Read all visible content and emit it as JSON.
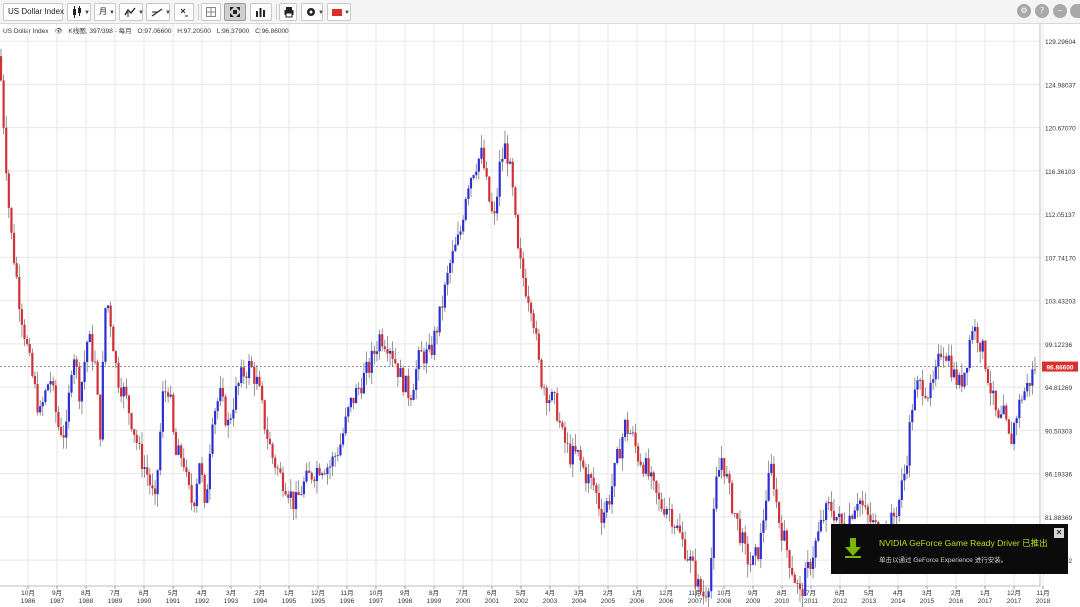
{
  "toolbar": {
    "symbol_label": "US Dollar Index",
    "interval_label": "月",
    "colors": {
      "active_bg": "#cfcfcf",
      "flag_red": "#d9302c"
    }
  },
  "chart_info": {
    "name": "US Dollar Index",
    "kline": "K线图, 397/398 - 每月",
    "open": "O:97.06600",
    "high": "H:97.20500",
    "low": "L:96.37900",
    "close": "C:96.86000"
  },
  "chart_data": {
    "type": "candlestick",
    "interval": "monthly",
    "current_price": 96.866,
    "current_price_label": "96.86600",
    "ylim": [
      75,
      131
    ],
    "y_ticks": [
      "129.29604",
      "124.98037",
      "120.67070",
      "116.36103",
      "112.05137",
      "107.74170",
      "103.43203",
      "99.12236",
      "94.81269",
      "90.50303",
      "86.19336",
      "81.88369",
      "77.57402"
    ],
    "x_ticks": [
      {
        "m": "10月",
        "y": "1986"
      },
      {
        "m": "9月",
        "y": "1987"
      },
      {
        "m": "8月",
        "y": "1988"
      },
      {
        "m": "7月",
        "y": "1989"
      },
      {
        "m": "6月",
        "y": "1990"
      },
      {
        "m": "5月",
        "y": "1991"
      },
      {
        "m": "4月",
        "y": "1992"
      },
      {
        "m": "3月",
        "y": "1993"
      },
      {
        "m": "2月",
        "y": "1994"
      },
      {
        "m": "1月",
        "y": "1995"
      },
      {
        "m": "12月",
        "y": "1995"
      },
      {
        "m": "11月",
        "y": "1996"
      },
      {
        "m": "10月",
        "y": "1997"
      },
      {
        "m": "9月",
        "y": "1998"
      },
      {
        "m": "8月",
        "y": "1999"
      },
      {
        "m": "7月",
        "y": "2000"
      },
      {
        "m": "6月",
        "y": "2001"
      },
      {
        "m": "5月",
        "y": "2002"
      },
      {
        "m": "4月",
        "y": "2003"
      },
      {
        "m": "3月",
        "y": "2004"
      },
      {
        "m": "2月",
        "y": "2005"
      },
      {
        "m": "1月",
        "y": "2006"
      },
      {
        "m": "12月",
        "y": "2006"
      },
      {
        "m": "11月",
        "y": "2007"
      },
      {
        "m": "10月",
        "y": "2008"
      },
      {
        "m": "9月",
        "y": "2009"
      },
      {
        "m": "8月",
        "y": "2010"
      },
      {
        "m": "7月",
        "y": "2011"
      },
      {
        "m": "6月",
        "y": "2012"
      },
      {
        "m": "5月",
        "y": "2013"
      },
      {
        "m": "4月",
        "y": "2014"
      },
      {
        "m": "3月",
        "y": "2015"
      },
      {
        "m": "2月",
        "y": "2016"
      },
      {
        "m": "1月",
        "y": "2017"
      },
      {
        "m": "12月",
        "y": "2017"
      },
      {
        "m": "11月",
        "y": "2018"
      }
    ],
    "anchors": [
      [
        0,
        127
      ],
      [
        10,
        111
      ],
      [
        20,
        103
      ],
      [
        30,
        97
      ],
      [
        40,
        92
      ],
      [
        50,
        96
      ],
      [
        58,
        91
      ],
      [
        66,
        90
      ],
      [
        73,
        99
      ],
      [
        80,
        94
      ],
      [
        88,
        100
      ],
      [
        95,
        97
      ],
      [
        100,
        90
      ],
      [
        106,
        104
      ],
      [
        110,
        102
      ],
      [
        117,
        96
      ],
      [
        125,
        94
      ],
      [
        133,
        91
      ],
      [
        140,
        88
      ],
      [
        148,
        86
      ],
      [
        155,
        83
      ],
      [
        163,
        94
      ],
      [
        169,
        95
      ],
      [
        175,
        88
      ],
      [
        183,
        88
      ],
      [
        187,
        85
      ],
      [
        193,
        83
      ],
      [
        200,
        88
      ],
      [
        205,
        82
      ],
      [
        212,
        92
      ],
      [
        220,
        94
      ],
      [
        228,
        91
      ],
      [
        235,
        94
      ],
      [
        242,
        96
      ],
      [
        250,
        97
      ],
      [
        258,
        95
      ],
      [
        265,
        91
      ],
      [
        272,
        88
      ],
      [
        280,
        86
      ],
      [
        287,
        85
      ],
      [
        295,
        83
      ],
      [
        303,
        85
      ],
      [
        310,
        86
      ],
      [
        320,
        87
      ],
      [
        330,
        87
      ],
      [
        340,
        89
      ],
      [
        350,
        93
      ],
      [
        360,
        95
      ],
      [
        370,
        97
      ],
      [
        380,
        100
      ],
      [
        390,
        99
      ],
      [
        400,
        96
      ],
      [
        410,
        94
      ],
      [
        420,
        98
      ],
      [
        430,
        98
      ],
      [
        440,
        102
      ],
      [
        450,
        107
      ],
      [
        460,
        110
      ],
      [
        467,
        115
      ],
      [
        475,
        117
      ],
      [
        482,
        118
      ],
      [
        488,
        114
      ],
      [
        494,
        111
      ],
      [
        500,
        117
      ],
      [
        506,
        119
      ],
      [
        512,
        115
      ],
      [
        518,
        108
      ],
      [
        525,
        105
      ],
      [
        532,
        103
      ],
      [
        540,
        96
      ],
      [
        548,
        94
      ],
      [
        556,
        93
      ],
      [
        562,
        90
      ],
      [
        570,
        88
      ],
      [
        578,
        88
      ],
      [
        586,
        86
      ],
      [
        594,
        85
      ],
      [
        602,
        82
      ],
      [
        610,
        84
      ],
      [
        618,
        88
      ],
      [
        625,
        91
      ],
      [
        632,
        90
      ],
      [
        638,
        88
      ],
      [
        645,
        87
      ],
      [
        652,
        85
      ],
      [
        660,
        83
      ],
      [
        668,
        83
      ],
      [
        676,
        81
      ],
      [
        684,
        79
      ],
      [
        692,
        77
      ],
      [
        698,
        75
      ],
      [
        704,
        74
      ],
      [
        710,
        76
      ],
      [
        716,
        85
      ],
      [
        722,
        88
      ],
      [
        730,
        84
      ],
      [
        738,
        81
      ],
      [
        746,
        78
      ],
      [
        752,
        77
      ],
      [
        760,
        79
      ],
      [
        766,
        84
      ],
      [
        772,
        87
      ],
      [
        778,
        82
      ],
      [
        786,
        79
      ],
      [
        794,
        76
      ],
      [
        800,
        74
      ],
      [
        806,
        76
      ],
      [
        812,
        78
      ],
      [
        818,
        80
      ],
      [
        824,
        82
      ],
      [
        830,
        83
      ],
      [
        836,
        82
      ],
      [
        842,
        81
      ],
      [
        850,
        82
      ],
      [
        858,
        84
      ],
      [
        866,
        82
      ],
      [
        874,
        81
      ],
      [
        882,
        80
      ],
      [
        890,
        81
      ],
      [
        898,
        83
      ],
      [
        906,
        87
      ],
      [
        912,
        93
      ],
      [
        918,
        95
      ],
      [
        924,
        95
      ],
      [
        930,
        94
      ],
      [
        936,
        96
      ],
      [
        942,
        99
      ],
      [
        948,
        98
      ],
      [
        954,
        96
      ],
      [
        960,
        95
      ],
      [
        966,
        97
      ],
      [
        972,
        101
      ],
      [
        978,
        100
      ],
      [
        984,
        98
      ],
      [
        990,
        95
      ],
      [
        998,
        91
      ],
      [
        1004,
        92
      ],
      [
        1010,
        89
      ],
      [
        1016,
        92
      ],
      [
        1022,
        94
      ],
      [
        1028,
        95
      ],
      [
        1035,
        96.866
      ]
    ],
    "colors": {
      "up": "#2b2fd6",
      "down": "#d0323a",
      "wick": "#6a6a6a",
      "price_badge": "#d9302c",
      "grid": "#e7e7e7"
    }
  },
  "notification": {
    "title": "NVIDIA GeForce Game Ready Driver 已推出",
    "subtitle": "单击以通过 GeForce Experience 进行安装。",
    "close_label": "✕",
    "icon": "download-arrow-icon",
    "colors": {
      "bg": "#0b0b0b",
      "title": "#b6e31b",
      "icon": "#76b900"
    }
  }
}
